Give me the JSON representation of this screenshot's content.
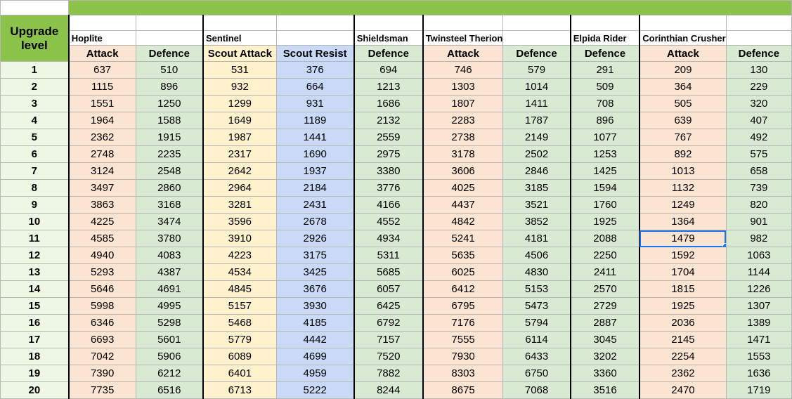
{
  "header": {
    "upgrade_label_line1": "Upgrade",
    "upgrade_label_line2": "level",
    "units": [
      "Hoplite",
      "",
      "Sentinel",
      "",
      "Shieldsman",
      "Twinsteel Therion",
      "",
      "Elpida Rider",
      "Corinthian Crusher",
      ""
    ],
    "columns": [
      "Attack",
      "Defence",
      "Scout Attack",
      "Scout Resist",
      "Defence",
      "Attack",
      "Defence",
      "Defence",
      "Attack",
      "Defence"
    ]
  },
  "column_colors": [
    "#fce4d3",
    "#d9ead3",
    "#fff2cc",
    "#c9daf8",
    "#d9ead3",
    "#fce4d3",
    "#d9ead3",
    "#d9ead3",
    "#fce4d3",
    "#d9ead3"
  ],
  "selected_cell": {
    "row": 11,
    "column_index": 8
  },
  "rows": [
    {
      "level": "1",
      "values": [
        "637",
        "510",
        "531",
        "376",
        "694",
        "746",
        "579",
        "291",
        "209",
        "130"
      ]
    },
    {
      "level": "2",
      "values": [
        "1115",
        "896",
        "932",
        "664",
        "1213",
        "1303",
        "1014",
        "509",
        "364",
        "229"
      ]
    },
    {
      "level": "3",
      "values": [
        "1551",
        "1250",
        "1299",
        "931",
        "1686",
        "1807",
        "1411",
        "708",
        "505",
        "320"
      ]
    },
    {
      "level": "4",
      "values": [
        "1964",
        "1588",
        "1649",
        "1189",
        "2132",
        "2283",
        "1787",
        "896",
        "639",
        "407"
      ]
    },
    {
      "level": "5",
      "values": [
        "2362",
        "1915",
        "1987",
        "1441",
        "2559",
        "2738",
        "2149",
        "1077",
        "767",
        "492"
      ]
    },
    {
      "level": "6",
      "values": [
        "2748",
        "2235",
        "2317",
        "1690",
        "2975",
        "3178",
        "2502",
        "1253",
        "892",
        "575"
      ]
    },
    {
      "level": "7",
      "values": [
        "3124",
        "2548",
        "2642",
        "1937",
        "3380",
        "3606",
        "2846",
        "1425",
        "1013",
        "658"
      ]
    },
    {
      "level": "8",
      "values": [
        "3497",
        "2860",
        "2964",
        "2184",
        "3776",
        "4025",
        "3185",
        "1594",
        "1132",
        "739"
      ]
    },
    {
      "level": "9",
      "values": [
        "3863",
        "3168",
        "3281",
        "2431",
        "4166",
        "4437",
        "3521",
        "1760",
        "1249",
        "820"
      ]
    },
    {
      "level": "10",
      "values": [
        "4225",
        "3474",
        "3596",
        "2678",
        "4552",
        "4842",
        "3852",
        "1925",
        "1364",
        "901"
      ]
    },
    {
      "level": "11",
      "values": [
        "4585",
        "3780",
        "3910",
        "2926",
        "4934",
        "5241",
        "4181",
        "2088",
        "1479",
        "982"
      ]
    },
    {
      "level": "12",
      "values": [
        "4940",
        "4083",
        "4223",
        "3175",
        "5311",
        "5635",
        "4506",
        "2250",
        "1592",
        "1063"
      ]
    },
    {
      "level": "13",
      "values": [
        "5293",
        "4387",
        "4534",
        "3425",
        "5685",
        "6025",
        "4830",
        "2411",
        "1704",
        "1144"
      ]
    },
    {
      "level": "14",
      "values": [
        "5646",
        "4691",
        "4845",
        "3676",
        "6057",
        "6412",
        "5153",
        "2570",
        "1815",
        "1226"
      ]
    },
    {
      "level": "15",
      "values": [
        "5998",
        "4995",
        "5157",
        "3930",
        "6425",
        "6795",
        "5473",
        "2729",
        "1925",
        "1307"
      ]
    },
    {
      "level": "16",
      "values": [
        "6346",
        "5298",
        "5468",
        "4185",
        "6792",
        "7176",
        "5794",
        "2887",
        "2036",
        "1389"
      ]
    },
    {
      "level": "17",
      "values": [
        "6693",
        "5601",
        "5779",
        "4442",
        "7157",
        "7555",
        "6114",
        "3045",
        "2145",
        "1471"
      ]
    },
    {
      "level": "18",
      "values": [
        "7042",
        "5906",
        "6089",
        "4699",
        "7520",
        "7930",
        "6433",
        "3202",
        "2254",
        "1553"
      ]
    },
    {
      "level": "19",
      "values": [
        "7390",
        "6212",
        "6401",
        "4959",
        "7882",
        "8303",
        "6750",
        "3360",
        "2362",
        "1636"
      ]
    },
    {
      "level": "20",
      "values": [
        "7735",
        "6516",
        "6713",
        "5222",
        "8244",
        "8675",
        "7068",
        "3516",
        "2470",
        "1719"
      ]
    }
  ]
}
